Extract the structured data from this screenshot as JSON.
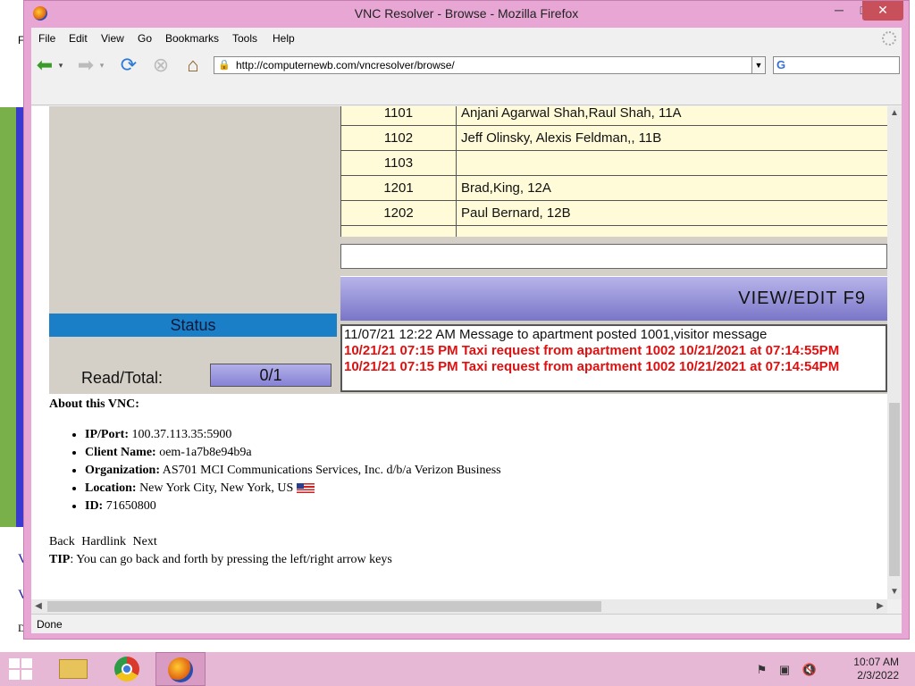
{
  "window": {
    "title": "VNC Resolver - Browse - Mozilla Firefox",
    "controls": {
      "minimize": "─",
      "maximize": "□",
      "close": "✕"
    }
  },
  "background_window": {
    "menu_letter": "F",
    "letters": [
      "V",
      "V",
      "D"
    ]
  },
  "menubar": [
    "File",
    "Edit",
    "View",
    "Go",
    "Bookmarks",
    "Tools",
    "Help"
  ],
  "navigation": {
    "url": "http://computernewb.com/vncresolver/browse/",
    "search_engine_glyph": "G",
    "icons": [
      "back-arrow-icon",
      "forward-arrow-icon",
      "reload-icon",
      "stop-icon",
      "home-icon"
    ]
  },
  "vnc_screen": {
    "apartments": [
      {
        "num": "1101",
        "names": "Anjani Agarwal Shah,Raul Shah, 11A"
      },
      {
        "num": "1102",
        "names": "Jeff Olinsky, Alexis Feldman,, 11B"
      },
      {
        "num": "1103",
        "names": ""
      },
      {
        "num": "1201",
        "names": "Brad,King, 12A"
      },
      {
        "num": "1202",
        "names": "Paul Bernard, 12B"
      }
    ],
    "view_edit_label": "VIEW/EDIT F9",
    "status_header": "Status",
    "read_total_label": "Read/Total:",
    "read_total_value": "0/1",
    "messages": [
      {
        "text": "11/07/21 12:22 AM Message to apartment posted 1001,visitor message",
        "kind": "normal"
      },
      {
        "text": "10/21/21 07:15 PM Taxi request from apartment 1002 10/21/2021 at 07:14:55PM",
        "kind": "alert"
      },
      {
        "text": "10/21/21 07:15 PM Taxi request from apartment 1002 10/21/2021 at 07:14:54PM",
        "kind": "alert"
      }
    ]
  },
  "about": {
    "heading": "About this VNC:",
    "items": [
      {
        "label": "IP/Port:",
        "value": "100.37.113.35:5900"
      },
      {
        "label": "Client Name:",
        "value": "oem-1a7b8e94b9a"
      },
      {
        "label": "Organization:",
        "value": "AS701 MCI Communications Services, Inc. d/b/a Verizon Business"
      },
      {
        "label": "Location:",
        "value": "New York City, New York, US"
      },
      {
        "label": "ID:",
        "value": "71650800"
      }
    ],
    "nav_links": [
      "Back",
      "Hardlink",
      "Next"
    ],
    "tip_label": "TIP",
    "tip_text": ": You can go back and forth by pressing the left/right arrow keys"
  },
  "statusbar": {
    "text": "Done"
  },
  "taskbar": {
    "apps": [
      "file-explorer-icon",
      "chrome-icon",
      "firefox-icon"
    ],
    "clock_time": "10:07 AM",
    "clock_date": "2/3/2022"
  },
  "colors": {
    "window_frame": "#e8a6d4",
    "status_header": "#1b7fc7",
    "alert_text": "#e01010",
    "table_row": "#fffbd8"
  }
}
